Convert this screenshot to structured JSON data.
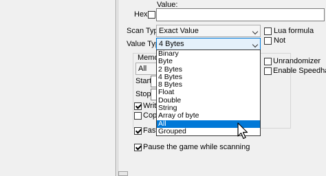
{
  "labels": {
    "value": "Value:",
    "hex": "Hex",
    "scan_type": "Scan Type",
    "value_type": "Value Type",
    "memory_partial": "Memo",
    "start": "Start",
    "stop": "Stop",
    "writable_partial": "Writa",
    "copy_partial": "Copy",
    "fast_partial": "Fast S",
    "pause": "Pause the game while scanning"
  },
  "scan_type": {
    "selected": "Exact Value"
  },
  "value_type": {
    "selected": "4 Bytes"
  },
  "region": {
    "selected": "All"
  },
  "options": {
    "lua_formula": "Lua formula",
    "not": "Not",
    "unrandomizer": "Unrandomizer",
    "speedhack": "Enable Speedhack"
  },
  "checkboxes": {
    "hex": false,
    "lua_formula": false,
    "not": false,
    "unrandomizer": false,
    "speedhack": false,
    "writable": true,
    "copy": false,
    "fast": true,
    "pause": true
  },
  "dropdown": {
    "items": [
      "Binary",
      "Byte",
      "2 Bytes",
      "4 Bytes",
      "8 Bytes",
      "Float",
      "Double",
      "String",
      "Array of byte",
      "All",
      "Grouped"
    ],
    "highlighted": "All"
  }
}
